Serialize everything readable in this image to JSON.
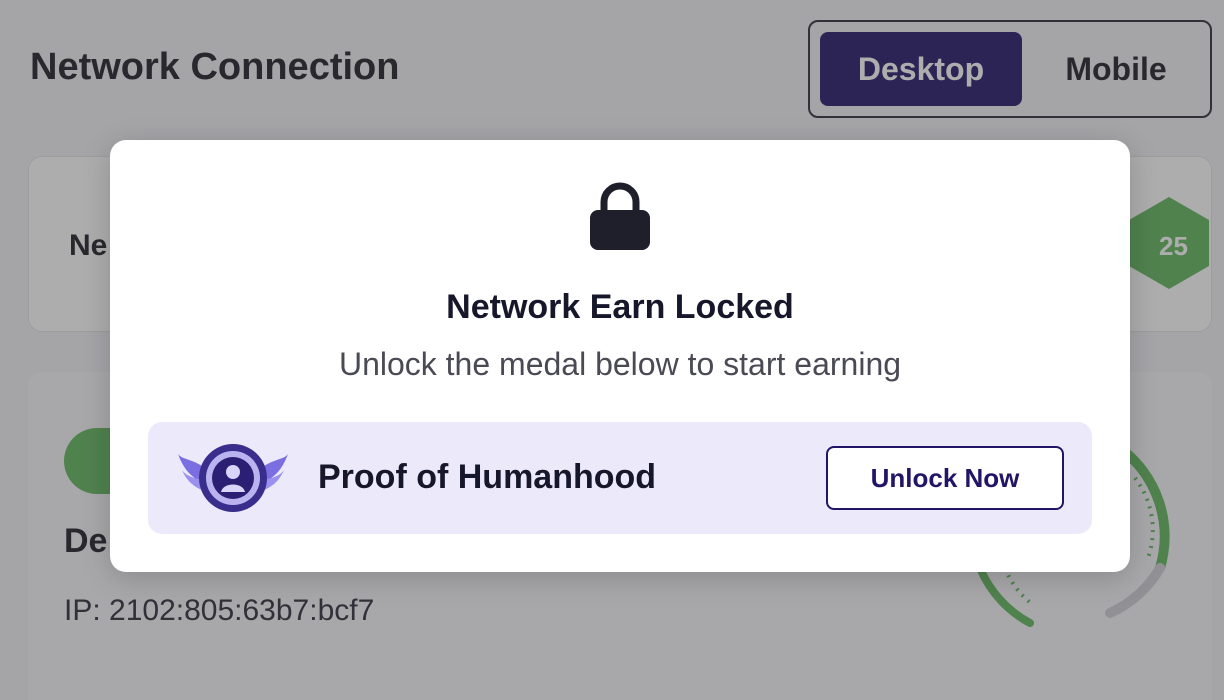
{
  "page": {
    "title": "Network Connection"
  },
  "view_toggle": {
    "options": [
      "Desktop",
      "Mobile"
    ],
    "selected": "Desktop"
  },
  "network_card": {
    "label_partial": "Ne",
    "badge_partial": "25"
  },
  "device_card": {
    "label_partial": "De",
    "ip_label": "IP:",
    "ip_value": "2102:805:63b7:bcf7"
  },
  "modal": {
    "icon": "lock-icon",
    "title": "Network Earn Locked",
    "subtitle": "Unlock the medal below to start earning",
    "medal": {
      "icon": "winged-medal-icon",
      "name": "Proof of Humanhood",
      "button_label": "Unlock Now"
    }
  },
  "colors": {
    "accent": "#221466",
    "success": "#5fb55a",
    "medal_row_bg": "#ece9fb",
    "overlay": "rgba(60,60,62,0.42)"
  }
}
